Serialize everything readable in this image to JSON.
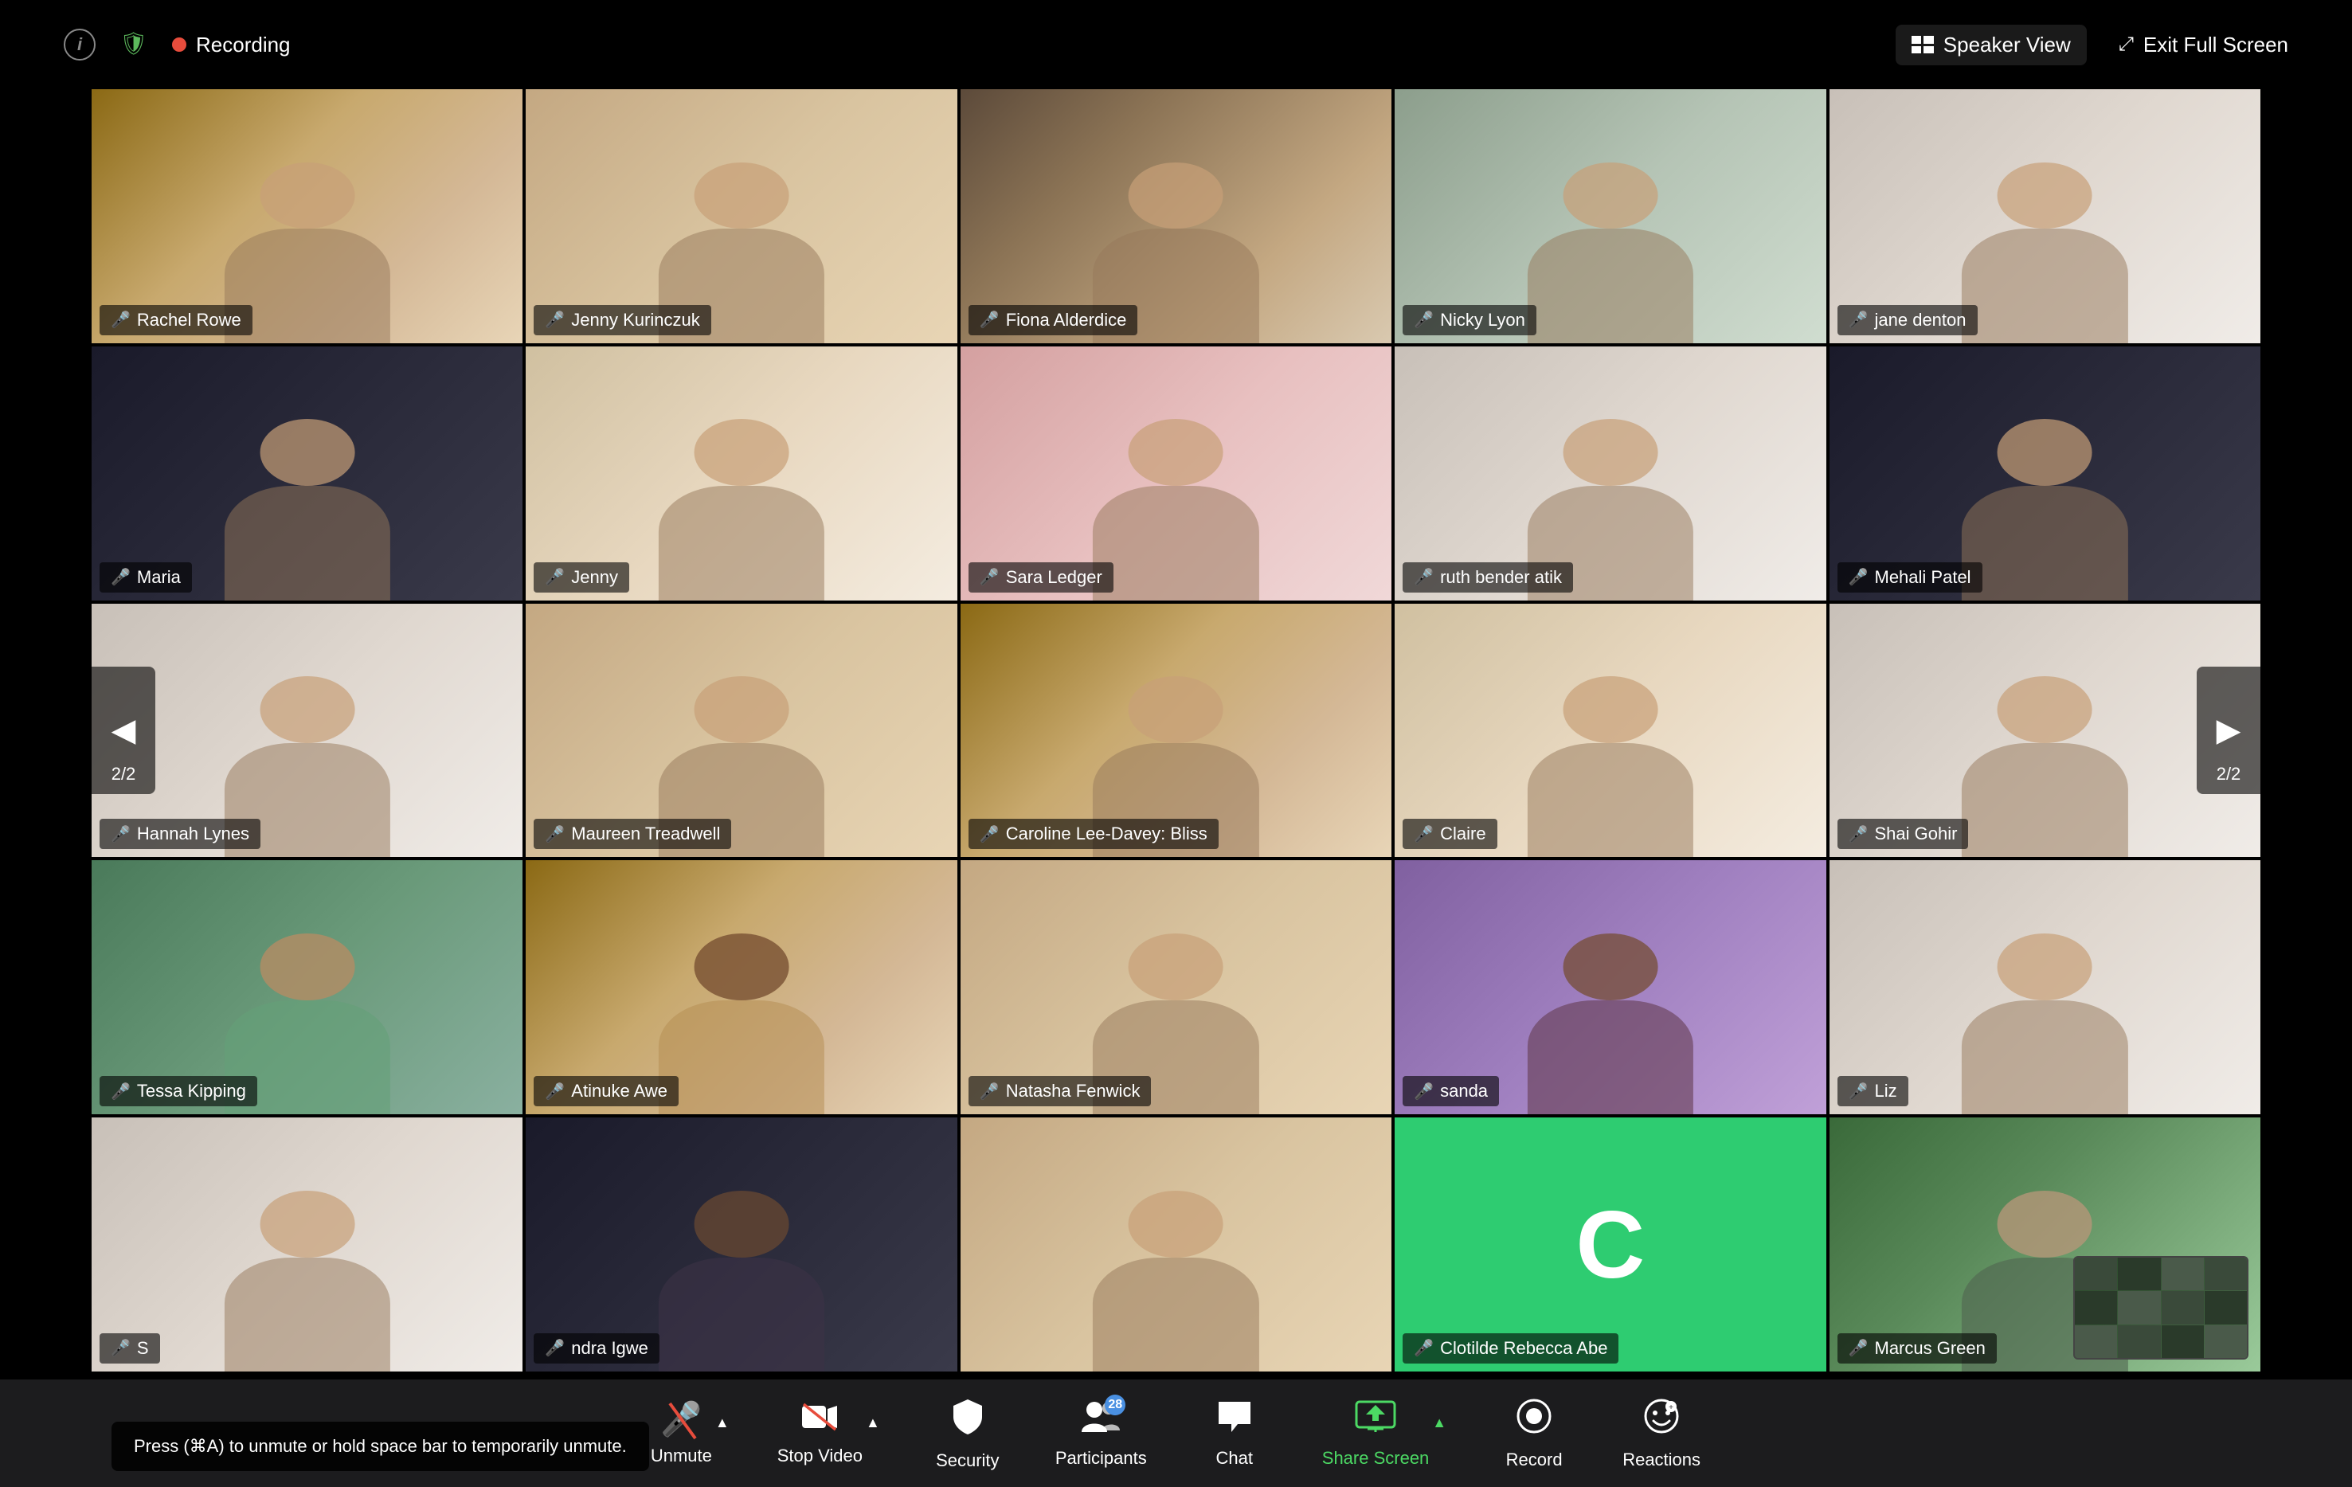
{
  "topBar": {
    "recordingLabel": "Recording",
    "speakerViewLabel": "Speaker View",
    "exitFullScreenLabel": "Exit Full Screen"
  },
  "navLeft": {
    "arrow": "◀",
    "page": "2/2"
  },
  "navRight": {
    "arrow": "▶",
    "page": "2/2"
  },
  "tooltip": {
    "text": "Press (⌘A) to unmute or hold space bar to temporarily unmute."
  },
  "participants": [
    {
      "name": "Rachel Rowe",
      "bg": "bg-warm",
      "muted": true
    },
    {
      "name": "Jenny Kurinczuk",
      "bg": "bg-beige",
      "muted": true
    },
    {
      "name": "Fiona Alderdice",
      "bg": "bg-room1",
      "muted": true
    },
    {
      "name": "Nicky Lyon",
      "bg": "bg-room2",
      "muted": true
    },
    {
      "name": "jane denton",
      "bg": "bg-light",
      "muted": true
    },
    {
      "name": "Maria",
      "bg": "bg-dark",
      "muted": true
    },
    {
      "name": "Jenny",
      "bg": "bg-cream",
      "muted": true
    },
    {
      "name": "Sara Ledger",
      "bg": "bg-pink",
      "muted": true
    },
    {
      "name": "ruth bender atik",
      "bg": "bg-light",
      "muted": true
    },
    {
      "name": "Mehali Patel",
      "bg": "bg-dark",
      "muted": true
    },
    {
      "name": "Hannah Lynes",
      "bg": "bg-light",
      "muted": true
    },
    {
      "name": "Maureen Treadwell",
      "bg": "bg-beige",
      "muted": true
    },
    {
      "name": "Caroline Lee-Davey: Bliss",
      "bg": "bg-warm",
      "muted": true
    },
    {
      "name": "Claire",
      "bg": "bg-cream",
      "muted": true
    },
    {
      "name": "Shai Gohir",
      "bg": "bg-light",
      "muted": true
    },
    {
      "name": "Tessa Kipping",
      "bg": "bg-green",
      "muted": true
    },
    {
      "name": "Atinuke Awe",
      "bg": "bg-warm",
      "muted": true
    },
    {
      "name": "Natasha Fenwick",
      "bg": "bg-beige",
      "muted": true
    },
    {
      "name": "sanda",
      "bg": "bg-purple",
      "muted": true
    },
    {
      "name": "Liz",
      "bg": "bg-light",
      "muted": true
    },
    {
      "name": "S",
      "bg": "bg-light",
      "muted": true
    },
    {
      "name": "ndra Igwe",
      "bg": "bg-dark",
      "muted": true
    },
    {
      "name": "",
      "bg": "bg-beige",
      "muted": true
    },
    {
      "name": "Clotilde Rebecca Abe",
      "bg": "bg-green2",
      "muted": true,
      "avatar": "C"
    },
    {
      "name": "Marcus Green",
      "bg": "bg-outdoor",
      "muted": true
    }
  ],
  "toolbar": {
    "unmuteLabel": "Unmute",
    "stopVideoLabel": "Stop Video",
    "securityLabel": "Security",
    "participantsLabel": "Participants",
    "participantsCount": "28",
    "chatLabel": "Chat",
    "shareScreenLabel": "Share Screen",
    "recordLabel": "Record",
    "reactionsLabel": "Reactions"
  }
}
